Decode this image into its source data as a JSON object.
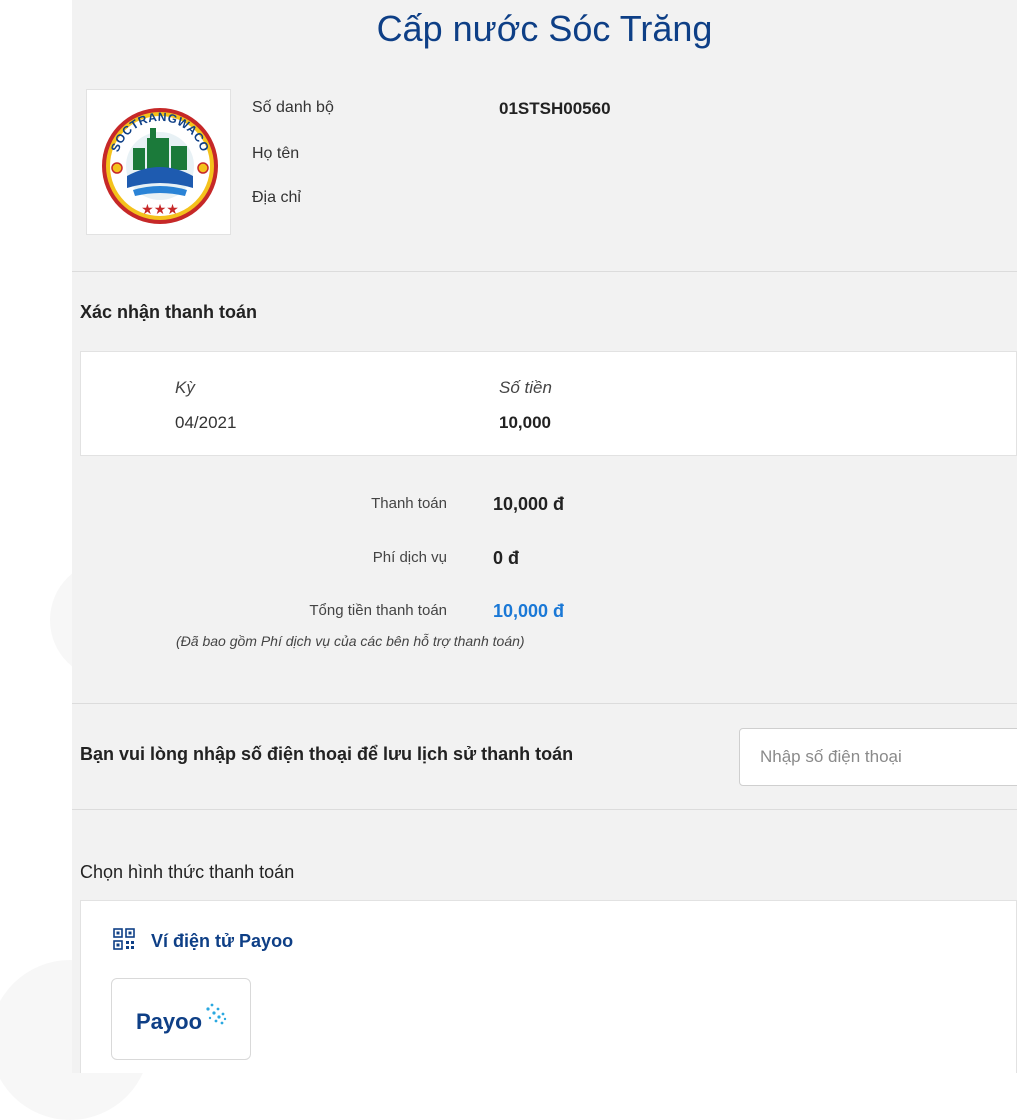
{
  "header": {
    "title": "Cấp nước Sóc Trăng"
  },
  "logo": {
    "text": "SOCTRANGWACO"
  },
  "customer": {
    "account_label": "Số danh bộ",
    "account_value": "01STSH00560",
    "name_label": "Họ tên",
    "address_label": "Địa chỉ"
  },
  "confirm": {
    "heading": "Xác nhận thanh toán",
    "period_label": "Kỳ",
    "period_value": "04/2021",
    "amount_label": "Số tiền",
    "amount_value": "10,000"
  },
  "summary": {
    "payment_label": "Thanh toán",
    "payment_value": "10,000 đ",
    "fee_label": "Phí dịch vụ",
    "fee_value": "0 đ",
    "total_label": "Tổng tiền thanh toán",
    "total_value": "10,000 đ",
    "note": "(Đã bao gồm Phí dịch vụ của các bên hỗ trợ thanh toán)"
  },
  "phone": {
    "label": "Bạn vui lòng nhập số điện thoại để lưu lịch sử thanh toán",
    "placeholder": "Nhập số điện thoại"
  },
  "payment_methods": {
    "heading": "Chọn hình thức thanh toán",
    "wallet_label": "Ví điện tử Payoo",
    "payoo_logo_text": "Payoo"
  },
  "colors": {
    "title": "#0e3f86",
    "total_accent": "#1a78d6",
    "panel_bg": "#f2f2f2"
  }
}
